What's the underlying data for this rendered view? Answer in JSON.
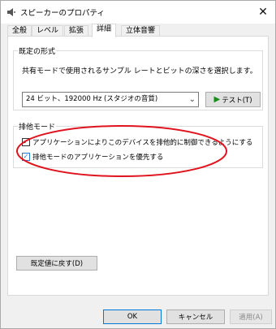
{
  "window": {
    "title": "スピーカーのプロパティ",
    "close_label": "✕"
  },
  "tabs": [
    {
      "label": "全般"
    },
    {
      "label": "レベル"
    },
    {
      "label": "拡張"
    },
    {
      "label": "詳細",
      "active": true
    },
    {
      "label": "立体音響"
    }
  ],
  "default_format": {
    "heading": "既定の形式",
    "description": "共有モードで使用されるサンプル レートとビットの深さを選択します。",
    "selected_value": "24 ビット、192000 Hz (スタジオの音質)",
    "test_label": "テスト(T)"
  },
  "exclusive_mode": {
    "heading": "排他モード",
    "options": [
      {
        "label": "アプリケーションによりこのデバイスを排他的に制御できるようにする",
        "checked": true
      },
      {
        "label": "排他モードのアプリケーションを優先する",
        "checked": true
      }
    ]
  },
  "restore_label": "既定値に戻す(D)",
  "buttons": {
    "ok": "OK",
    "cancel": "キャンセル",
    "apply": "適用(A)"
  },
  "colors": {
    "annotation": "#e0141e",
    "accent": "#0078d7",
    "checkbox": "#2878d0"
  }
}
